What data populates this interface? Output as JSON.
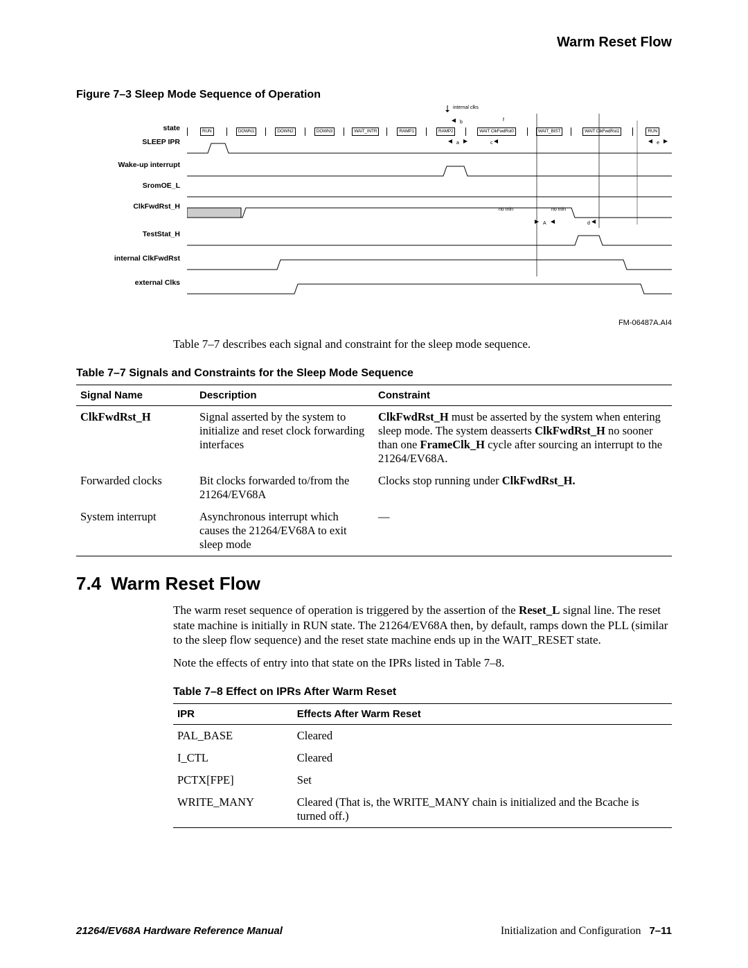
{
  "header": {
    "running_head": "Warm Reset Flow"
  },
  "figure": {
    "caption": "Figure 7–3  Sleep Mode Sequence of Operation",
    "id": "FM-06487A.AI4",
    "top_anno": "internal clks",
    "letters": {
      "a": "a",
      "b": "b",
      "c": "c",
      "d": "d",
      "e": "e",
      "f": "f",
      "A": "A",
      "nomin1": "no min",
      "nomin2": "no min"
    },
    "signals": {
      "state": "state",
      "sleep_ipr": "SLEEP IPR",
      "wakeup": "Wake-up interrupt",
      "sromoe": "SromOE_L",
      "clkfwdrst": "ClkFwdRst_H",
      "teststat": "TestStat_H",
      "int_clkfwd": "internal ClkFwdRst",
      "ext_clks": "external Clks"
    },
    "states": [
      "RUN",
      "DOWN1",
      "DOWN2",
      "DOWN3",
      "WAIT_INTR",
      "RAMP1",
      "RAMP2",
      "WAIT ClkFwdRst0",
      "WAIT_BIST",
      "WAIT ClkFwdRst1",
      "RUN"
    ]
  },
  "intro_text": "Table 7–7 describes each signal and constraint for the sleep mode sequence.",
  "table7": {
    "title": "Table 7–7  Signals and Constraints for the Sleep Mode Sequence",
    "headers": [
      "Signal Name",
      "Description",
      "Constraint"
    ],
    "rows": [
      {
        "name": "ClkFwdRst_H",
        "name_bold": true,
        "desc": "Signal asserted by the system to initialize and reset clock forwarding interfaces",
        "constraint_html": "<b>ClkFwdRst_H</b> must be asserted by the system when entering sleep mode.  The system deasserts <b>ClkFwdRst_H</b> no sooner than one <b>FrameClk_H</b> cycle after sourcing an interrupt to the 21264/EV68A."
      },
      {
        "name": "Forwarded clocks",
        "name_bold": false,
        "desc": "Bit clocks forwarded to/from the 21264/EV68A",
        "constraint_html": "Clocks stop running under <b>ClkFwdRst_H.</b>"
      },
      {
        "name": "System interrupt",
        "name_bold": false,
        "desc": "Asynchronous interrupt which causes the 21264/EV68A to exit sleep mode",
        "constraint_html": "—"
      }
    ]
  },
  "section": {
    "number": "7.4",
    "title": "Warm Reset Flow"
  },
  "section_body": {
    "p1_html": "The warm reset sequence of operation is triggered by the assertion of the <b>Reset_L</b> signal line. The reset state machine is initially in RUN state. The 21264/EV68A then, by default, ramps down the PLL (similar to the sleep flow sequence) and the reset state machine ends up in the WAIT_RESET state.",
    "p2": "Note the effects of entry into that state on the IPRs listed in Table 7–8."
  },
  "table8": {
    "title": "Table 7–8  Effect on IPRs After Warm Reset",
    "headers": [
      "IPR",
      "Effects After Warm Reset"
    ],
    "rows": [
      {
        "ipr": "PAL_BASE",
        "effect": "Cleared"
      },
      {
        "ipr": "I_CTL",
        "effect": "Cleared"
      },
      {
        "ipr": "PCTX[FPE]",
        "effect": "Set"
      },
      {
        "ipr": "WRITE_MANY",
        "effect": "Cleared  (That is, the WRITE_MANY chain is initialized and the Bcache is turned off.)"
      }
    ]
  },
  "footer": {
    "manual": "21264/EV68A Hardware Reference Manual",
    "chapter": "Initialization and Configuration",
    "page": "7–11"
  }
}
